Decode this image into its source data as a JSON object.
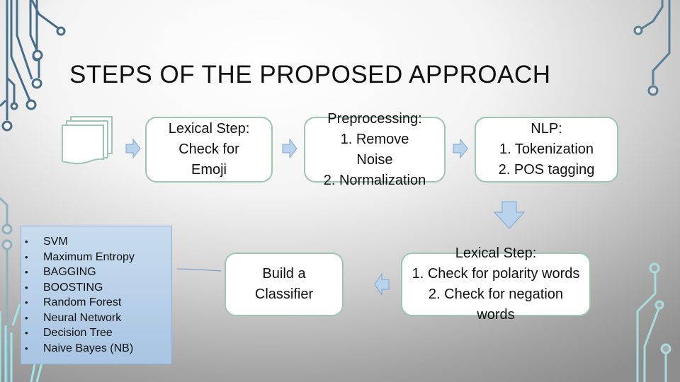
{
  "slide": {
    "title": "STEPS OF THE PROPOSED APPROACH"
  },
  "icons": {
    "documents": "documents-stack-icon",
    "arrow_right": "arrow-right-icon",
    "arrow_down": "arrow-down-icon",
    "arrow_left": "arrow-left-icon"
  },
  "flow": {
    "steps": [
      {
        "id": "lexical-emoji",
        "text": "Lexical Step:\nCheck for\nEmoji"
      },
      {
        "id": "preprocessing",
        "text": "Preprocessing:\n1. Remove\n   Noise\n2. Normalization"
      },
      {
        "id": "nlp",
        "text": "NLP:\n1. Tokenization\n2. POS tagging"
      },
      {
        "id": "lexical-polarity",
        "text": "Lexical Step:\n1. Check for polarity words\n2. Check for negation\nwords"
      },
      {
        "id": "classifier",
        "text": "Build a\nClassifier"
      }
    ]
  },
  "classifiers": {
    "items": [
      "SVM",
      "Maximum Entropy",
      "BAGGING",
      "BOOSTING",
      "Random Forest",
      "Neural Network",
      "Decision Tree",
      "Naive Bayes (NB)"
    ]
  },
  "colors": {
    "box_border": "#9dc5b2",
    "arrow_fill": "#b9d3ec",
    "arrow_stroke": "#7fa6cf",
    "list_bg": "#b8d0ea",
    "circuit_dark": "#3e6680",
    "circuit_light": "#a9dcdc"
  }
}
